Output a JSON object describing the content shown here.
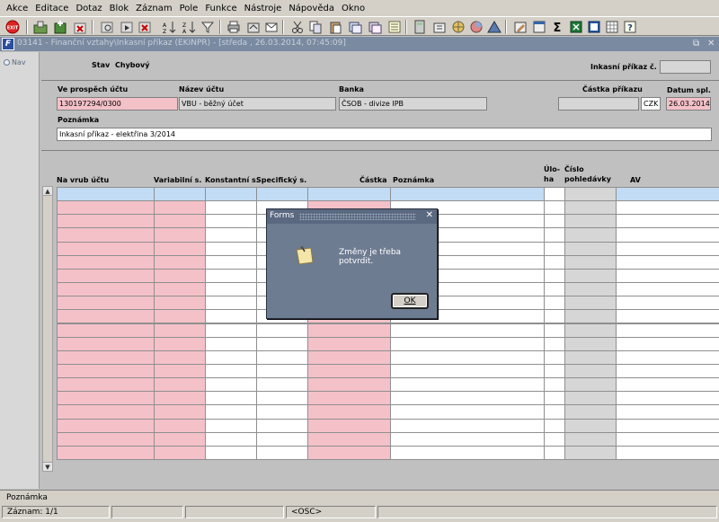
{
  "menu": [
    "Akce",
    "Editace",
    "Dotaz",
    "Blok",
    "Záznam",
    "Pole",
    "Funkce",
    "Nástroje",
    "Nápověda",
    "Okno"
  ],
  "toolbar": {
    "exit_label": "EXIT",
    "icons": [
      "exit-icon",
      "save-icon",
      "insert-record-icon",
      "delete-record-icon",
      "print-icon",
      "enter-query-icon",
      "execute-query-icon",
      "sort-icon",
      "filter-icon",
      "print-report-icon",
      "export-icon",
      "mail-icon",
      "cut-icon",
      "copy-icon",
      "paste-icon",
      "duplicate-icon",
      "attach-icon",
      "calculator-icon",
      "globe-icon",
      "chart-icon",
      "warning-icon",
      "list-icon",
      "edit-icon",
      "excel-icon",
      "word-icon",
      "sum-icon",
      "spreadsheet-icon",
      "arrow-icon",
      "help-icon"
    ],
    "sum_glyph": "Σ"
  },
  "window": {
    "title": "03141 - Finanční vztahy\\Inkasní příkaz (EKINPR) - [středa , 26.03.2014, 07:45:09]",
    "app_icon_label": "F",
    "restore_glyph": "⧉",
    "close_glyph": "✕"
  },
  "nav": {
    "label": "Nav"
  },
  "header": {
    "stav_label": "Stav",
    "stav_value": "Chybový",
    "inkasni_label": "Inkasní příkaz č.",
    "inkasni_value": "",
    "ve_prospech_label": "Ve prospěch účtu",
    "ve_prospech_value": "130197294/0300",
    "nazev_uctu_label": "Název účtu",
    "nazev_uctu_value": "VBU - běžný účet",
    "banka_label": "Banka",
    "banka_value": "ČSOB - divize IPB",
    "castka_prikazu_label": "Částka příkazu",
    "castka_prikazu_value": "",
    "mena_value": "CZK",
    "datum_spl_label": "Datum spl.",
    "datum_spl_value": "26.03.2014",
    "poznamka_label": "Poznámka",
    "poznamka_value": "Inkasní příkaz - elektřina 3/2014"
  },
  "table": {
    "columns": [
      "Na vrub účtu",
      "Variabilní s.",
      "Konstantní s.",
      "Specifický s.",
      "Částka",
      "Poznámka",
      "Úlo-\nha",
      "Číslo\npohledávky",
      "AV"
    ],
    "row_count": 20
  },
  "dialog": {
    "title": "Forms",
    "message": "Změny je třeba potvrdit.",
    "ok_label": "OK",
    "close_glyph": "✕"
  },
  "status": {
    "field_hint": "Poznámka",
    "record": "Záznam: 1/1",
    "mode": "<OSC>"
  }
}
